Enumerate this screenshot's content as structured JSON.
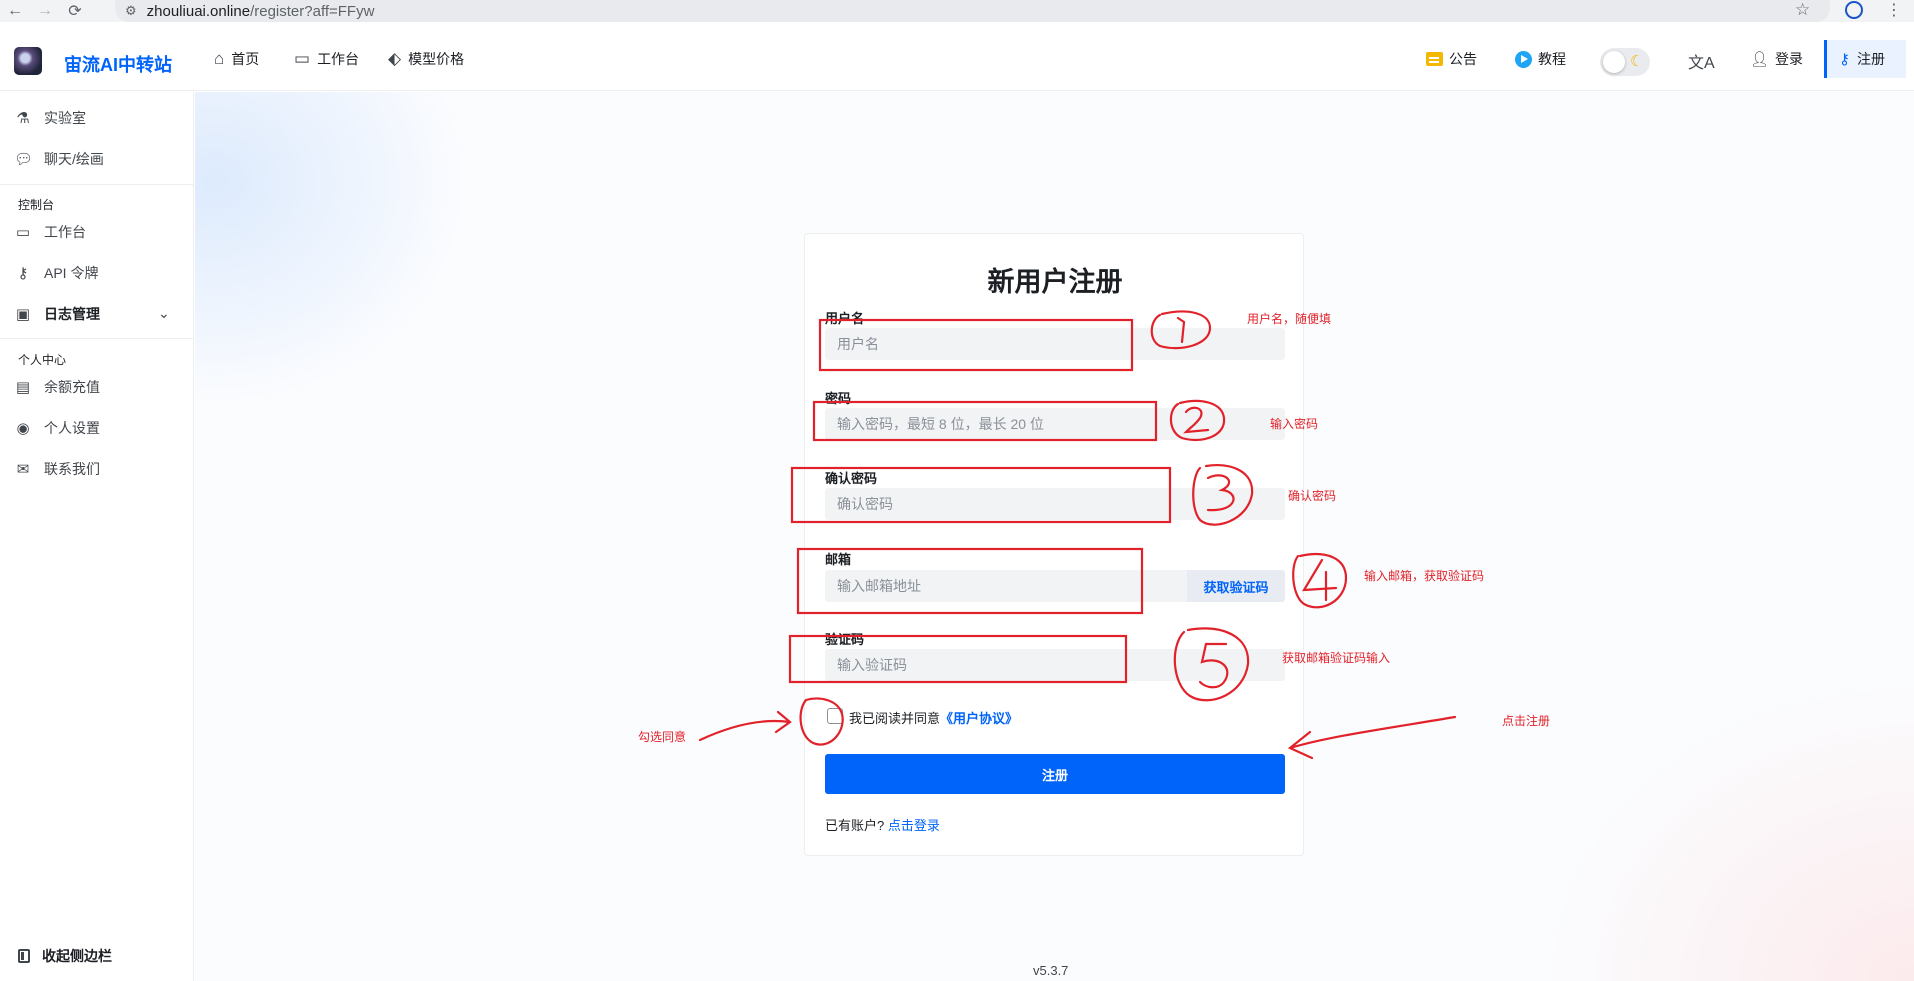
{
  "browser": {
    "url_host": "zhouliuai.online",
    "url_path": "/register?aff=FFyw"
  },
  "header": {
    "brand": "宙流AI中转站",
    "nav": [
      {
        "label": "首页",
        "icon": "home-icon"
      },
      {
        "label": "工作台",
        "icon": "monitor-icon"
      },
      {
        "label": "模型价格",
        "icon": "tag-icon"
      }
    ],
    "announcement": "公告",
    "tutorial": "教程",
    "login": "登录",
    "register": "注册"
  },
  "sidebar": {
    "items_top": [
      {
        "label": "实验室",
        "icon": "flask-icon"
      },
      {
        "label": "聊天/绘画",
        "icon": "chat-icon"
      }
    ],
    "group_console": "控制台",
    "items_console": [
      {
        "label": "工作台",
        "icon": "monitor-icon"
      },
      {
        "label": "API 令牌",
        "icon": "key-icon"
      },
      {
        "label": "日志管理",
        "icon": "calendar-icon"
      }
    ],
    "group_personal": "个人中心",
    "items_personal": [
      {
        "label": "余额充值",
        "icon": "wallet-icon"
      },
      {
        "label": "个人设置",
        "icon": "user-circle-icon"
      },
      {
        "label": "联系我们",
        "icon": "mail-icon"
      }
    ],
    "collapse": "收起侧边栏"
  },
  "form": {
    "title": "新用户注册",
    "username_label": "用户名",
    "username_placeholder": "用户名",
    "password_label": "密码",
    "password_placeholder": "输入密码，最短 8 位，最长 20 位",
    "confirm_label": "确认密码",
    "confirm_placeholder": "确认密码",
    "email_label": "邮箱",
    "email_placeholder": "输入邮箱地址",
    "get_code": "获取验证码",
    "code_label": "验证码",
    "code_placeholder": "输入验证码",
    "agree_text": "我已阅读并同意",
    "agree_link": "《用户协议》",
    "submit": "注册",
    "have_account": "已有账户?",
    "login_link": "点击登录"
  },
  "version": "v5.3.7",
  "annotations": {
    "n1": "用户名，随便填",
    "n2": "输入密码",
    "n3": "确认密码",
    "n4": "输入邮箱，获取验证码",
    "n5": "获取邮箱验证码输入",
    "check": "勾选同意",
    "click": "点击注册",
    "color": "#e2222a"
  }
}
